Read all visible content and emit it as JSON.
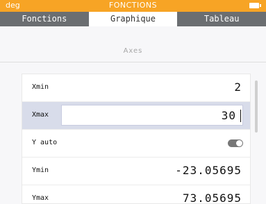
{
  "status": {
    "left": "deg",
    "title": "FONCTIONS"
  },
  "tabs": [
    {
      "label": "Fonctions"
    },
    {
      "label": "Graphique"
    },
    {
      "label": "Tableau"
    }
  ],
  "section": {
    "title": "Axes"
  },
  "rows": [
    {
      "label": "Xmin",
      "value": "2"
    },
    {
      "label": "Xmax",
      "value": "30"
    },
    {
      "label": "Y auto"
    },
    {
      "label": "Ymin",
      "value": "-23.05695"
    },
    {
      "label": "Ymax",
      "value": "73.05695"
    }
  ],
  "colors": {
    "accent": "#f7a425",
    "tabbar": "#6b6e71",
    "edit_highlight": "#d8dcea"
  }
}
